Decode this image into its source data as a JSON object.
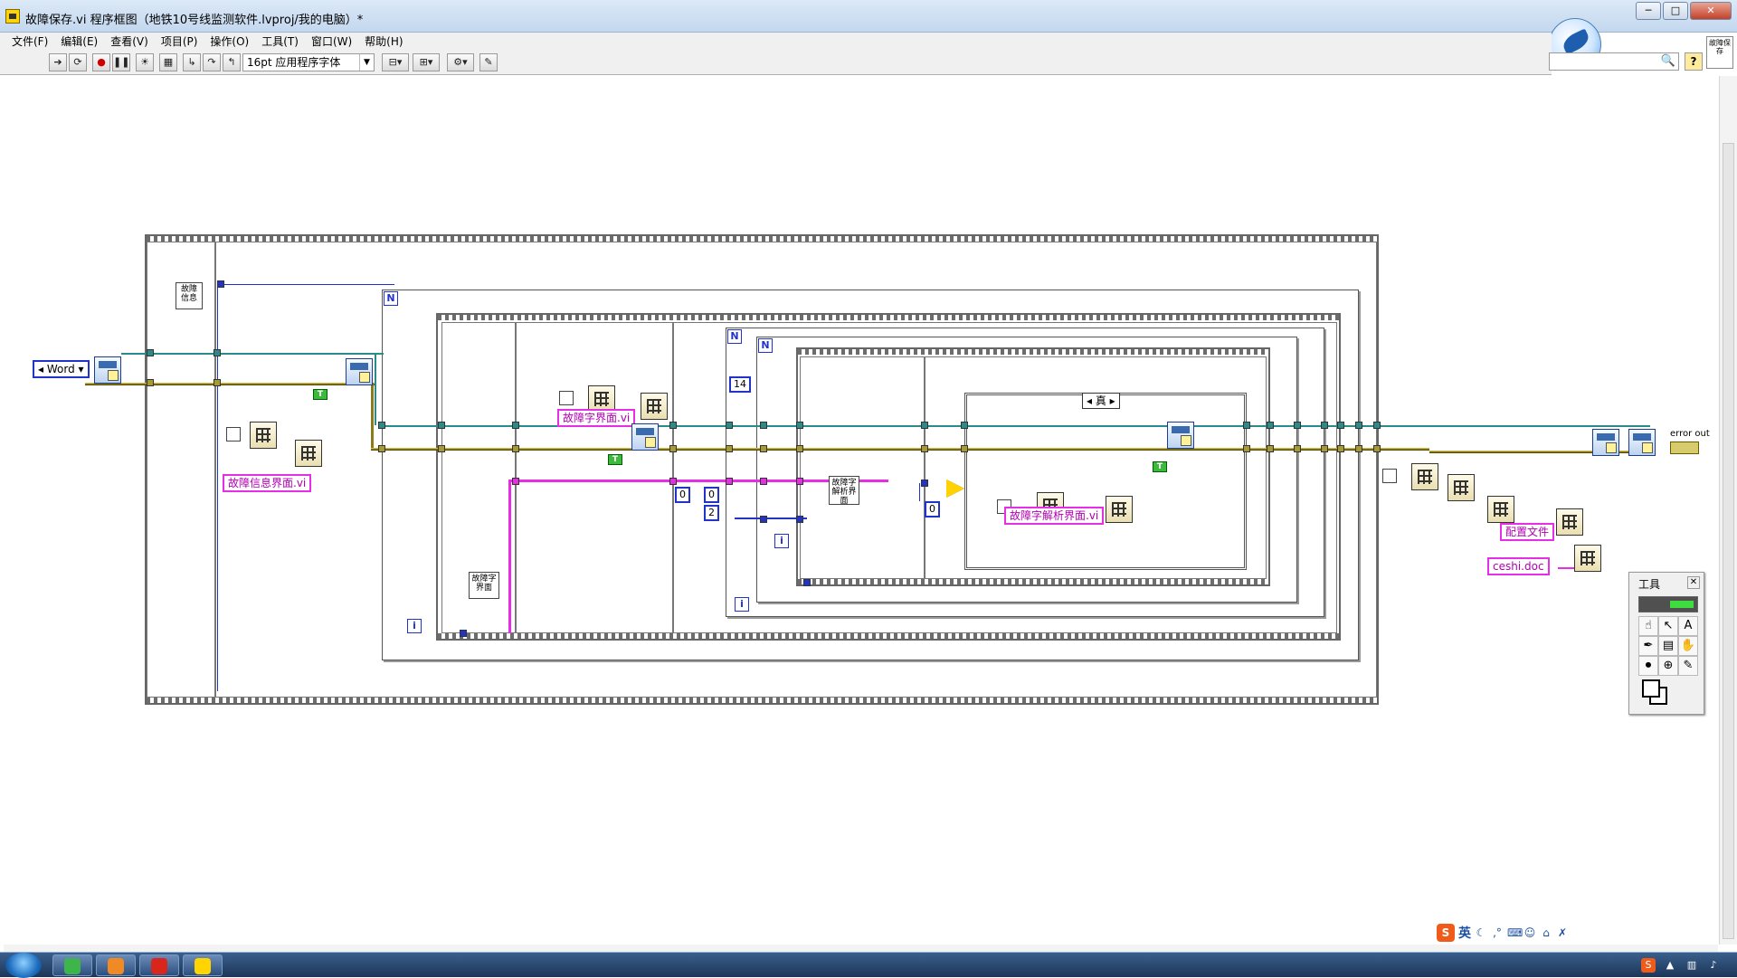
{
  "window": {
    "title": "故障保存.vi 程序框图（地铁10号线监测软件.lvproj/我的电脑）*",
    "minimize": "─",
    "maximize": "□",
    "close": "✕"
  },
  "menu": {
    "items": [
      "文件(F)",
      "编辑(E)",
      "查看(V)",
      "项目(P)",
      "操作(O)",
      "工具(T)",
      "窗口(W)",
      "帮助(H)"
    ]
  },
  "toolbar": {
    "font_select": "16pt 应用程序字体",
    "help": "?",
    "icon_pane_text": "故障保存"
  },
  "diagram": {
    "enum_word": "Word",
    "strings": {
      "fault_info_vi": "故障信息界面.vi",
      "fault_word_vi": "故障字界面.vi",
      "fault_parse_vi": "故障字解析界面.vi",
      "config_file": "配置文件",
      "ceshi_doc": "ceshi.doc"
    },
    "subvis": {
      "fault_info_label": "故障信息",
      "fault_word_ui_label": "故障字界面",
      "fault_word_parse_label": "故障字解析界面"
    },
    "constants": {
      "n14": "14",
      "zero_a": "0",
      "zero_b": "0",
      "two": "2",
      "zero_c": "0"
    },
    "loop_labels": {
      "N": "N",
      "i": "i",
      "T": "T"
    },
    "case_selector": "真",
    "error_out": "error out"
  },
  "tools_palette": {
    "title": "工具",
    "close": "✕"
  },
  "ime": {
    "logo": "S",
    "lang": "英"
  },
  "colors": {
    "wire_refnum": "#2b8a8a",
    "wire_error": "#8d7a1a",
    "wire_string": "#e52ee5",
    "wire_numeric": "#2233cc",
    "boolean_const": "#3fb83f"
  }
}
